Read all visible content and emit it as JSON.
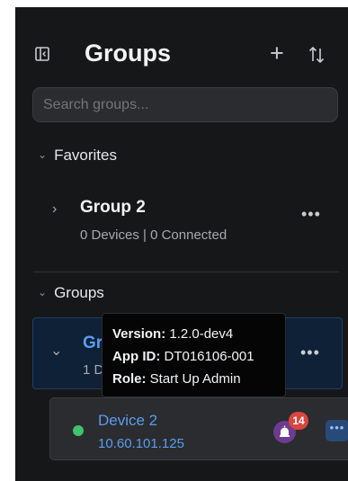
{
  "header": {
    "title": "Groups",
    "add_label": "+",
    "icons": [
      "sidebar-collapse-icon",
      "sort-icon"
    ]
  },
  "search": {
    "placeholder": "Search groups..."
  },
  "favorites": {
    "label": "Favorites",
    "items": [
      {
        "name": "Group 2",
        "devices": "0 Devices",
        "connected": "0 Connected",
        "menu": "•••"
      }
    ]
  },
  "groups": {
    "label": "Groups",
    "items": [
      {
        "name": "Gr",
        "sub": "1 D",
        "menu": "•••",
        "expanded": true,
        "devices": [
          {
            "name": "Device 2",
            "ip": "10.60.101.125",
            "status": "connected",
            "alarm_count": "14",
            "menu": "•••"
          }
        ]
      }
    ]
  },
  "tooltip": {
    "version_label": "Version:",
    "version": "1.2.0-dev4",
    "app_id_label": "App ID:",
    "app_id": "DT016106-001",
    "role_label": "Role:",
    "role": "Start Up Admin"
  },
  "colors": {
    "panel_bg": "#161718",
    "accent": "#5b9cf0",
    "status_ok": "#3fc36b",
    "badge": "#d9453f",
    "alarm_bg": "#6e3b8f"
  }
}
